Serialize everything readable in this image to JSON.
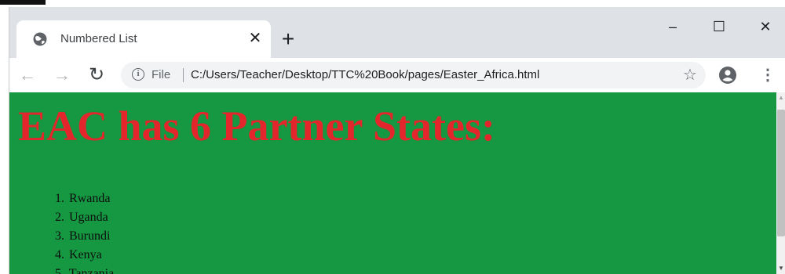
{
  "tab": {
    "title": "Numbered List",
    "favicon": "globe-icon"
  },
  "window_controls": {
    "minimize": "–",
    "maximize": "☐",
    "close": "✕"
  },
  "toolbar": {
    "back": "←",
    "forward": "→",
    "reload": "↻",
    "info": "i",
    "file_label": "File",
    "url": "C:/Users/Teacher/Desktop/TTC%20Book/pages/Easter_Africa.html",
    "star": "☆",
    "menu": "⋮"
  },
  "page": {
    "heading": "EAC has 6 Partner States:",
    "states": [
      {
        "num": "1.",
        "name": "Rwanda"
      },
      {
        "num": "2.",
        "name": "Uganda"
      },
      {
        "num": "3.",
        "name": "Burundi"
      },
      {
        "num": "4.",
        "name": "Kenya"
      },
      {
        "num": "5.",
        "name": "Tanzania"
      }
    ]
  },
  "colors": {
    "page_background": "#159841",
    "heading": "#e3262b",
    "tabstrip": "#dee1e6"
  }
}
